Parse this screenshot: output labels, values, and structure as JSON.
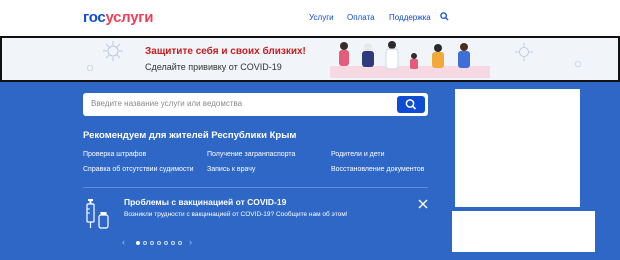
{
  "header": {
    "logo_part1": "гос",
    "logo_part2": "услуги",
    "nav": [
      {
        "label": "Услуги"
      },
      {
        "label": "Оплата"
      },
      {
        "label": "Поддержка"
      }
    ],
    "search_icon": "search-icon"
  },
  "banner": {
    "title": "Защитите себя и своих близких!",
    "subtitle": "Сделайте прививку от COVID-19"
  },
  "search": {
    "placeholder": "Введите название услуги или ведомства"
  },
  "recommend": {
    "title": "Рекомендуем для жителей Республики Крым",
    "links": [
      "Проверка штрафов",
      "Получение загранпаспорта",
      "Родители и дети",
      "Справка об отсутствии судимости",
      "Запись к врачу",
      "Восстановление документов"
    ]
  },
  "covid": {
    "title": "Проблемы с вакцинацией от COVID-19",
    "text": "Возникли трудности с вакцинацией от COVID-19? Сообщите нам об этом!"
  },
  "pager": {
    "prev": "‹",
    "next": "›",
    "dots": 7,
    "active": 0
  },
  "colors": {
    "brand_blue": "#0d4cd3",
    "brand_red": "#ee3f58",
    "main_bg": "#2f67c6"
  }
}
